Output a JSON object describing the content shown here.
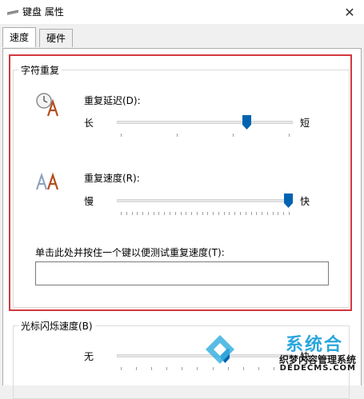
{
  "window": {
    "title": "键盘 属性"
  },
  "tabs": [
    {
      "label": "速度",
      "active": true
    },
    {
      "label": "硬件",
      "active": false
    }
  ],
  "char_repeat": {
    "group_title": "字符重复",
    "delay": {
      "label": "重复延迟(D):",
      "min_label": "长",
      "max_label": "短",
      "level": 0.75
    },
    "rate": {
      "label": "重复速度(R):",
      "min_label": "慢",
      "max_label": "快",
      "level": 1.0
    },
    "test_label": "单击此处并按住一个键以便测试重复速度(T):",
    "test_value": ""
  },
  "cursor_blink": {
    "group_title": "光标闪烁速度(B)",
    "min_label": "无",
    "max_label": "快",
    "level": 0.62
  },
  "watermark": {
    "brand": "系统合",
    "cms": "织梦内容管理系统",
    "domain": "DEDECMS.COM"
  },
  "colors": {
    "accent": "#0063b1",
    "highlight": "#d2383f"
  }
}
